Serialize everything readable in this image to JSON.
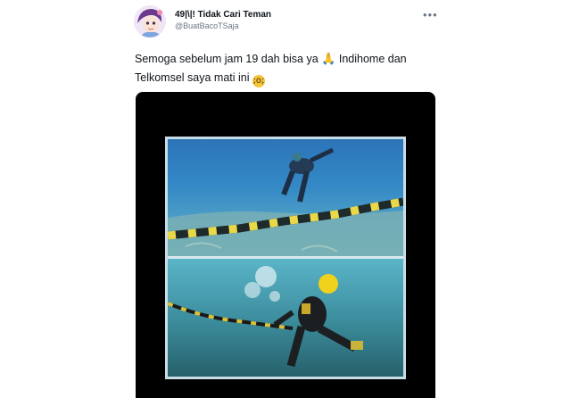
{
  "user": {
    "display_name": "49|\\|! Tidak Cari Teman",
    "handle": "@BuatBacoTSaja"
  },
  "menu_icon": "more-horizontal-icon",
  "tweet": {
    "line1_part1": "Semoga sebelum jam 19 dah bisa ya",
    "line1_part2": "Indihome dan",
    "line2": "Telkomsel saya mati ini",
    "emoji_1": "folded-hands",
    "emoji_2": "loudly-crying-face"
  },
  "colors": {
    "text": "#0f1419",
    "secondary": "#6b7785",
    "media_background": "#000000"
  }
}
